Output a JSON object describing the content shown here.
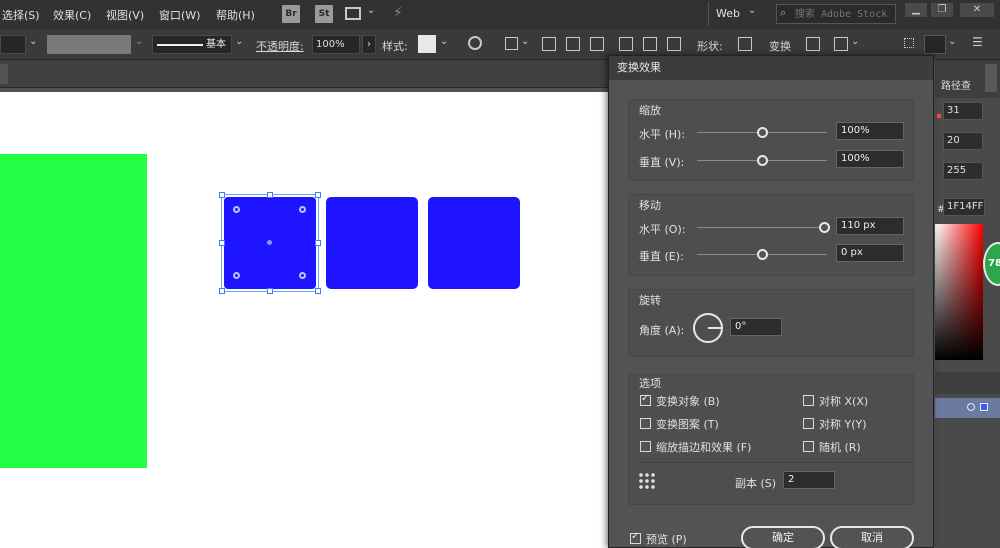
{
  "menubar": {
    "items": [
      "选择(S)",
      "效果(C)",
      "视图(V)",
      "窗口(W)",
      "帮助(H)"
    ],
    "app_icons": [
      "Br",
      "St"
    ],
    "workspace": "Web",
    "search_placeholder": "搜索 Adobe Stock"
  },
  "toolbar": {
    "stroke_label": "基本",
    "opacity_label": "不透明度:",
    "opacity_value": "100%",
    "style_label": "样式:",
    "shape_label": "形状:",
    "transform_label": "变换"
  },
  "right_panel": {
    "tab_label": "路径查",
    "r": "31",
    "g": "20",
    "b": "255",
    "hex": "1F14FF",
    "badge": "78"
  },
  "colors": {
    "green_rect": "#22ff44",
    "blue_square": "#1f14ff"
  },
  "dialog": {
    "title": "变换效果",
    "scale": {
      "label": "缩放",
      "h_label": "水平 (H):",
      "h_value": "100%",
      "v_label": "垂直 (V):",
      "v_value": "100%"
    },
    "move": {
      "label": "移动",
      "h_label": "水平 (O):",
      "h_value": "110 px",
      "v_label": "垂直 (E):",
      "v_value": "0 px"
    },
    "rotate": {
      "label": "旋转",
      "angle_label": "角度 (A):",
      "angle_value": "0°"
    },
    "options": {
      "label": "选项",
      "transform_objects": "变换对象 (B)",
      "transform_patterns": "变换图案 (T)",
      "scale_strokes": "缩放描边和效果 (F)",
      "reflect_x": "对称 X(X)",
      "reflect_y": "对称 Y(Y)",
      "random": "随机 (R)",
      "copies_label": "副本 (S)",
      "copies_value": "2"
    },
    "preview": "预览 (P)",
    "ok": "确定",
    "cancel": "取消"
  }
}
